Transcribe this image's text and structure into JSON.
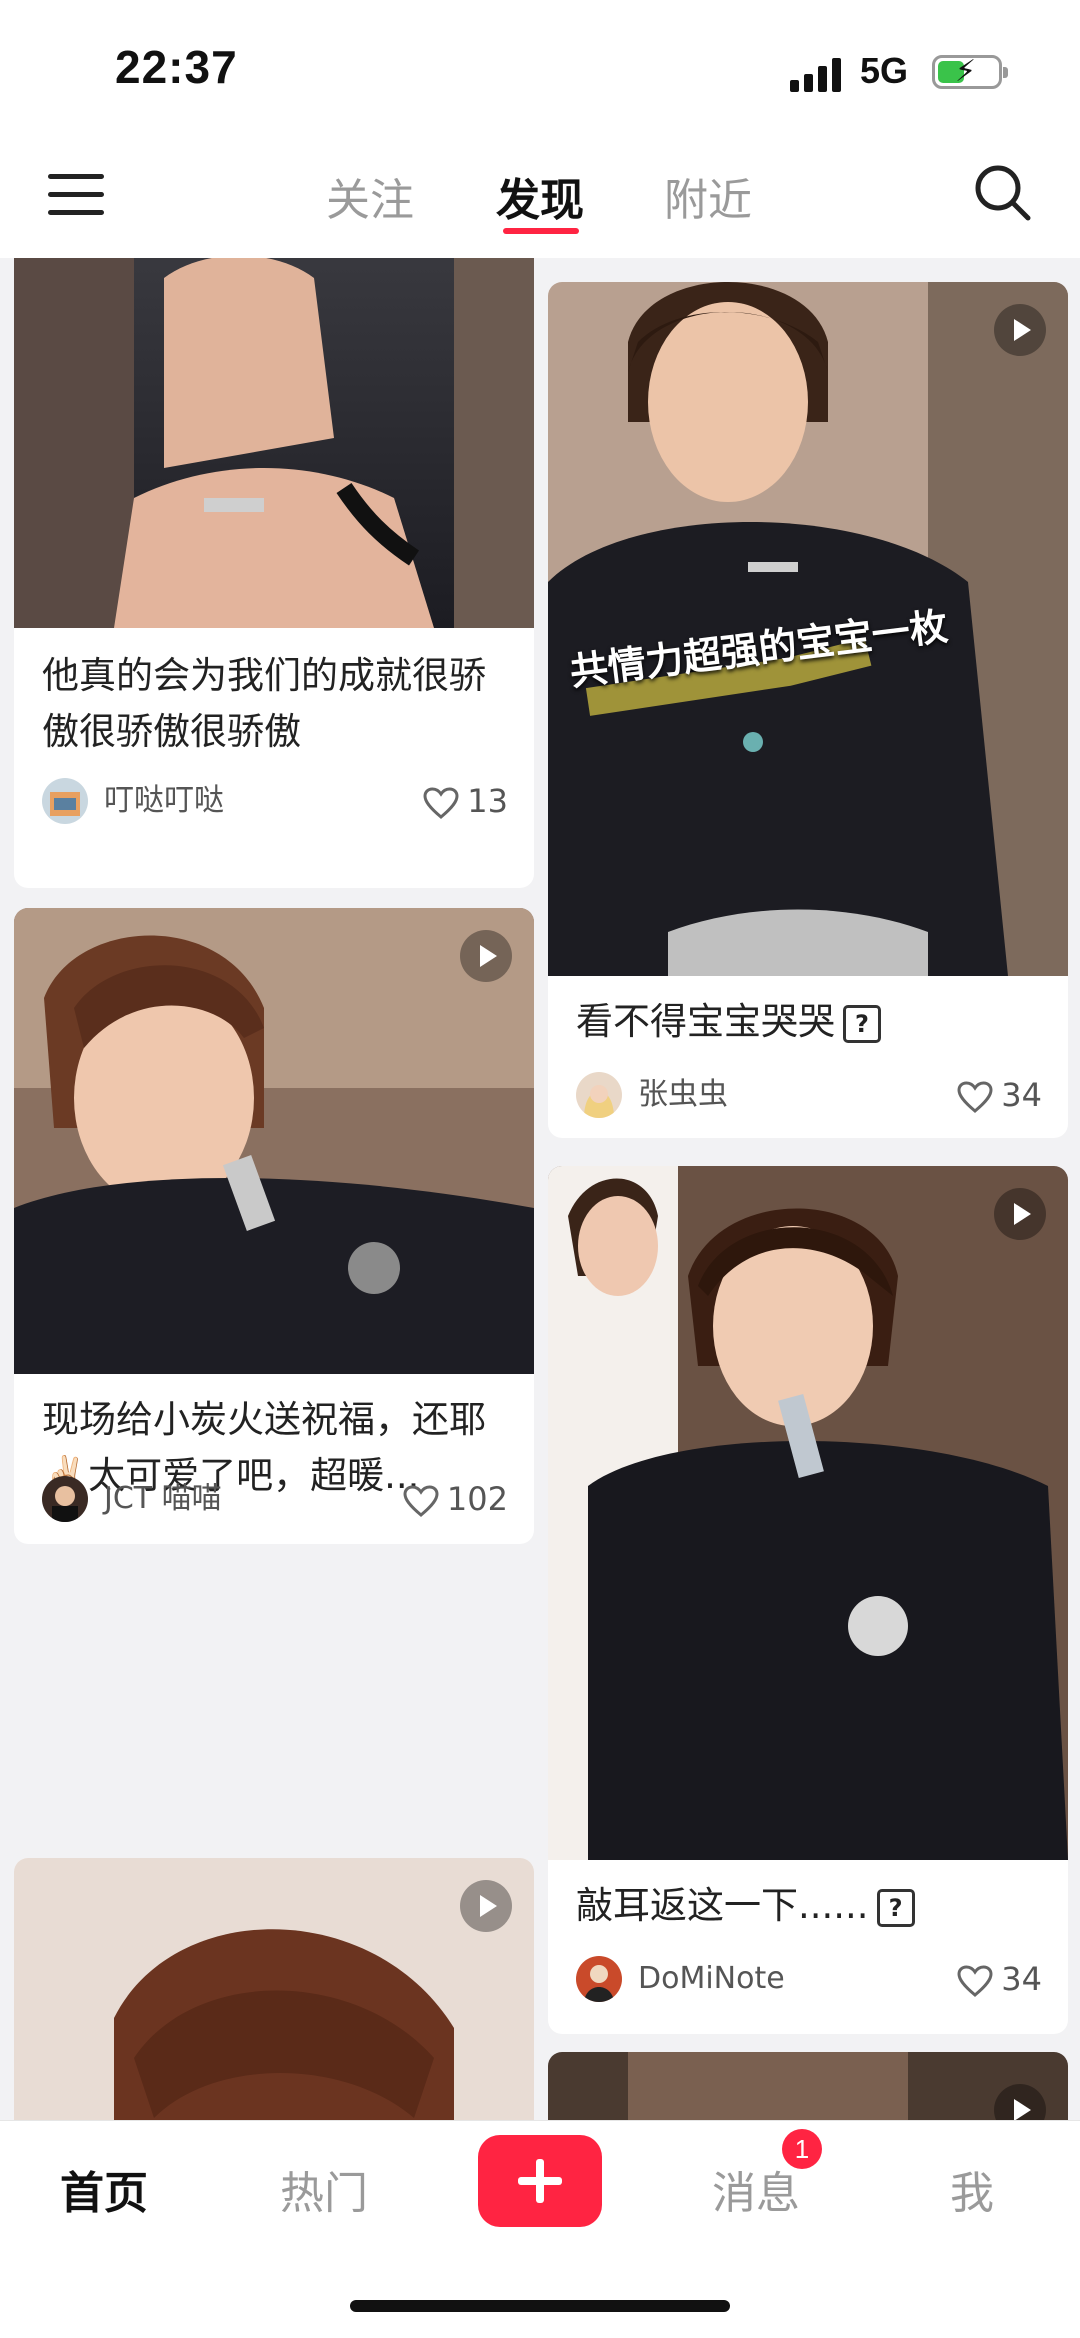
{
  "status_bar": {
    "time": "22:37",
    "network": "5G"
  },
  "top_nav": {
    "tabs": [
      {
        "label": "关注",
        "active": false
      },
      {
        "label": "发现",
        "active": true
      },
      {
        "label": "附近",
        "active": false
      }
    ],
    "accent_color": "#ff2442"
  },
  "feed": {
    "left": [
      {
        "title": "他真的会为我们的成就很骄傲很骄傲很骄傲",
        "author": "叮哒叮哒",
        "likes": "13"
      },
      {
        "title": "现场给小炭火送祝福，还耶✌🏻太可爱了吧，超暖...",
        "author": "JCT 喵喵",
        "likes": "102"
      }
    ],
    "right": [
      {
        "overlay_text": "共情力超强的宝宝一枚",
        "title": "看不得宝宝哭哭",
        "author": "张虫虫",
        "likes": "34"
      },
      {
        "title": "敲耳返这一下......",
        "author": "DoMiNote",
        "likes": "34"
      }
    ]
  },
  "tab_bar": {
    "items": [
      {
        "label": "首页",
        "active": true
      },
      {
        "label": "热门",
        "active": false
      },
      {
        "label": "消息",
        "active": false
      },
      {
        "label": "我",
        "active": false
      }
    ],
    "messages_badge": "1"
  }
}
